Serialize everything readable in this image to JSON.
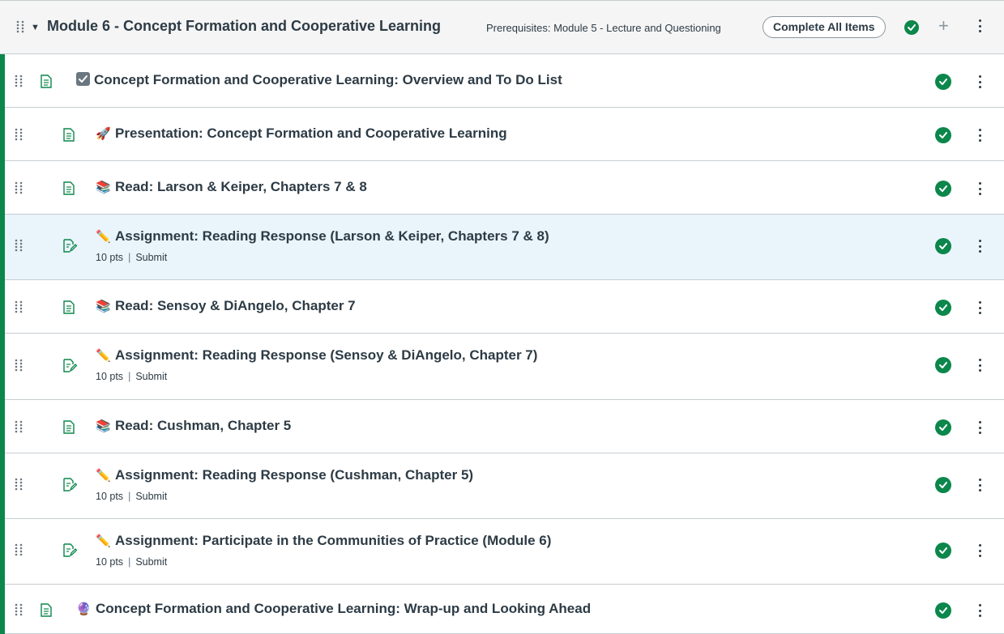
{
  "module": {
    "title": "Module 6 - Concept Formation and Cooperative Learning",
    "prerequisites": "Prerequisites: Module 5 - Lecture and Questioning",
    "complete_label": "Complete All Items",
    "accent_color": "#0b874b"
  },
  "items": [
    {
      "type": "page",
      "emoji": "checkbox",
      "title": "Concept Formation and Cooperative Learning: Overview and To Do List",
      "meta": null
    },
    {
      "type": "page",
      "emoji": "🚀",
      "title": "Presentation: Concept Formation and Cooperative Learning",
      "meta": null
    },
    {
      "type": "page",
      "emoji": "📚",
      "title": "Read: Larson & Keiper, Chapters 7 & 8",
      "meta": null
    },
    {
      "type": "assignment",
      "emoji": "✏️",
      "title": "Assignment: Reading Response (Larson & Keiper, Chapters 7 & 8)",
      "meta": {
        "points": "10 pts",
        "action": "Submit"
      }
    },
    {
      "type": "page",
      "emoji": "📚",
      "title": "Read: Sensoy & DiAngelo, Chapter 7",
      "meta": null
    },
    {
      "type": "assignment",
      "emoji": "✏️",
      "title": "Assignment: Reading Response (Sensoy & DiAngelo, Chapter 7)",
      "meta": {
        "points": "10 pts",
        "action": "Submit"
      }
    },
    {
      "type": "page",
      "emoji": "📚",
      "title": "Read: Cushman, Chapter 5",
      "meta": null
    },
    {
      "type": "assignment",
      "emoji": "✏️",
      "title": "Assignment: Reading Response (Cushman, Chapter 5)",
      "meta": {
        "points": "10 pts",
        "action": "Submit"
      }
    },
    {
      "type": "assignment",
      "emoji": "✏️",
      "title": "Assignment: Participate in the Communities of Practice (Module 6)",
      "meta": {
        "points": "10 pts",
        "action": "Submit"
      }
    },
    {
      "type": "page",
      "emoji": "🔮",
      "title": "Concept Formation and Cooperative Learning: Wrap-up and Looking Ahead",
      "meta": null
    }
  ]
}
